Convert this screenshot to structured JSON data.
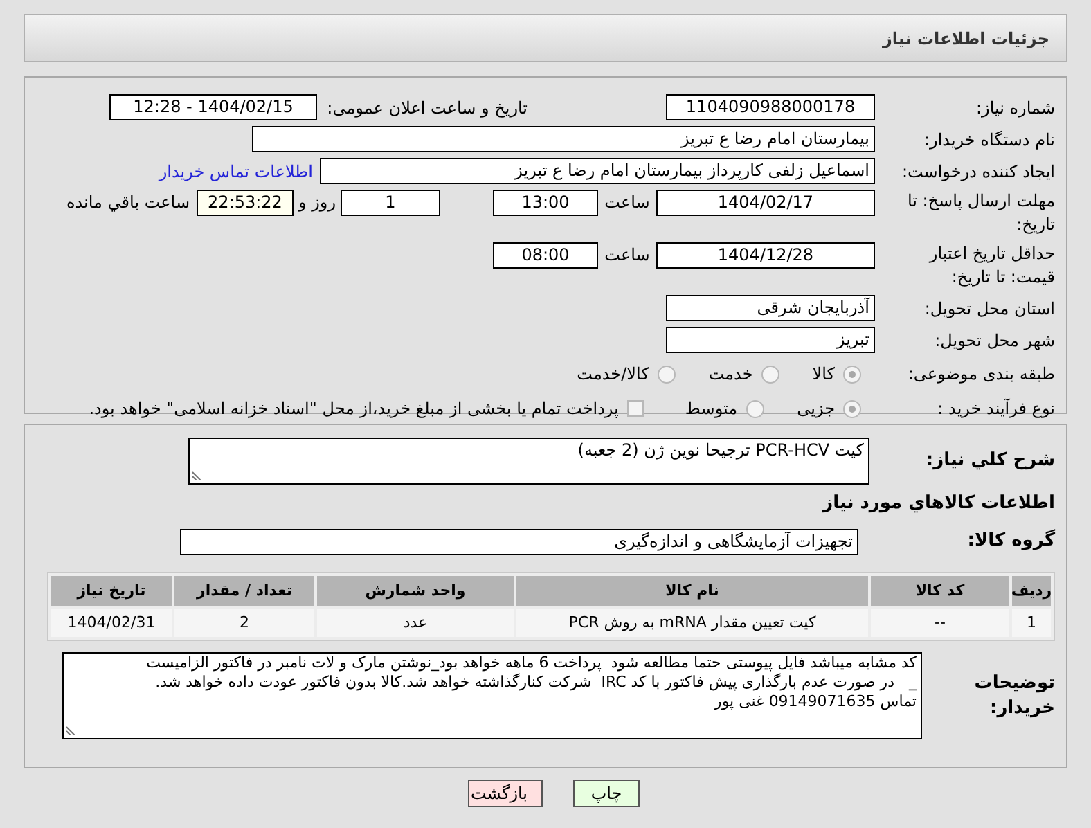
{
  "header": {
    "title": "جزئیات اطلاعات نیاز"
  },
  "need_number": {
    "label": "شماره نیاز:",
    "value": "1104090988000178"
  },
  "announce": {
    "label": "تاریخ و ساعت اعلان عمومی:",
    "value": "1404/02/15 - 12:28"
  },
  "buyer_org": {
    "label": "نام دستگاه خریدار:",
    "value": "بیمارستان امام رضا  ع  تبریز"
  },
  "creator": {
    "label": "ایجاد کننده درخواست:",
    "value": "اسماعیل زلفی کارپرداز بیمارستان امام رضا  ع  تبریز",
    "link": "اطلاعات تماس خریدار"
  },
  "deadline": {
    "label": "مهلت ارسال پاسخ: تا تاریخ:",
    "date": "1404/02/17",
    "time_label": "ساعت",
    "time": "13:00",
    "days": "1",
    "days_label": "روز و",
    "remaining": "22:53:22",
    "remaining_label": "ساعت باقي مانده"
  },
  "validity": {
    "label": "حداقل تاریخ اعتبار قیمت: تا تاریخ:",
    "date": "1404/12/28",
    "time_label": "ساعت",
    "time": "08:00"
  },
  "province": {
    "label": "استان محل تحویل:",
    "value": "آذربایجان شرقی"
  },
  "city": {
    "label": "شهر محل تحویل:",
    "value": "تبریز"
  },
  "category": {
    "label": "طبقه بندی موضوعی:",
    "options": [
      {
        "label": "کالا",
        "selected": true
      },
      {
        "label": "خدمت",
        "selected": false
      },
      {
        "label": "کالا/خدمت",
        "selected": false
      }
    ]
  },
  "process": {
    "label": "نوع فرآیند خرید :",
    "options": [
      {
        "label": "جزیی",
        "selected": true
      },
      {
        "label": "متوسط",
        "selected": false
      }
    ],
    "treasury": {
      "checked": false,
      "label": "پرداخت تمام یا بخشی از مبلغ خرید،از محل \"اسناد خزانه اسلامی\" خواهد بود."
    }
  },
  "description": {
    "label": "شرح كلي نياز:",
    "value": "کیت   PCR-HCV ترجیحا نوین ژن (2 جعبه)"
  },
  "goods_heading": "اطلاعات كالاهاي مورد نياز",
  "goods_group": {
    "label": "گروه کالا:",
    "value": "تجهیزات آزمایشگاهی و اندازه‌گیری"
  },
  "table": {
    "columns": [
      "ردیف",
      "کد کالا",
      "نام کالا",
      "واحد شمارش",
      "تعداد / مقدار",
      "تاریخ نیاز"
    ],
    "rows": [
      [
        "1",
        "--",
        "کیت تعیین مقدار mRNA به روش PCR",
        "عدد",
        "2",
        "1404/02/31"
      ]
    ]
  },
  "notes": {
    "label": "توضیحات خریدار:",
    "lines": [
      "کد مشابه میباشد فایل پیوستی حتما مطالعه شود  پرداخت 6 ماهه خواهد بود_نوشتن مارک و لات نامبر در فاکتور الزامیست",
      "_   در صورت عدم بارگذاری پیش فاکتور با کد IRC  شرکت کنارگذاشته خواهد شد.کالا بدون فاکتور عودت داده خواهد شد.",
      "تماس 09149071635 غنی پور"
    ]
  },
  "buttons": [
    {
      "label": "چاپ",
      "kind": "print"
    },
    {
      "label": "بازگشت",
      "kind": "back"
    }
  ]
}
